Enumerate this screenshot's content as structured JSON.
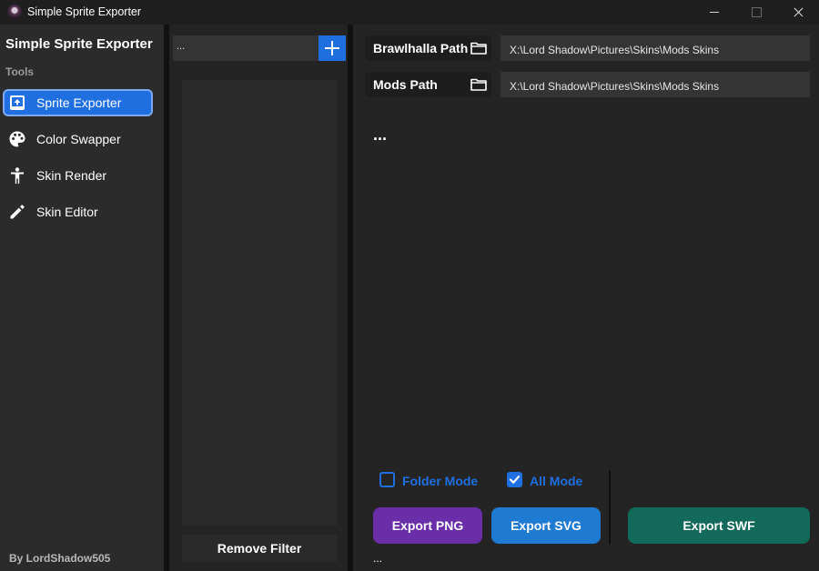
{
  "window": {
    "title": "Simple Sprite Exporter"
  },
  "sidebar": {
    "title": "Simple Sprite Exporter",
    "section": "Tools",
    "items": [
      {
        "label": "Sprite Exporter",
        "icon": "image-upload-icon",
        "active": true
      },
      {
        "label": "Color Swapper",
        "icon": "palette-icon",
        "active": false
      },
      {
        "label": "Skin Render",
        "icon": "person-icon",
        "active": false
      },
      {
        "label": "Skin Editor",
        "icon": "pencil-icon",
        "active": false
      }
    ],
    "footer": "By LordShadow505"
  },
  "filter": {
    "input_value": "...",
    "remove_label": "Remove Filter"
  },
  "paths": [
    {
      "label": "Brawlhalla Path",
      "value": "X:\\Lord Shadow\\Pictures\\Skins\\Mods Skins"
    },
    {
      "label": "Mods Path",
      "value": "X:\\Lord Shadow\\Pictures\\Skins\\Mods Skins"
    }
  ],
  "status_main": "...",
  "options": {
    "folder_mode": {
      "label": "Folder Mode",
      "checked": false
    },
    "all_mode": {
      "label": "All Mode",
      "checked": true
    }
  },
  "buttons": {
    "export_png": "Export PNG",
    "export_svg": "Export SVG",
    "export_swf": "Export SWF"
  },
  "status_bottom": "...",
  "colors": {
    "accent": "#1f6fe0",
    "png_button": "#6a2fa8",
    "svg_button": "#1f7ad1",
    "swf_button": "#136a5a"
  }
}
